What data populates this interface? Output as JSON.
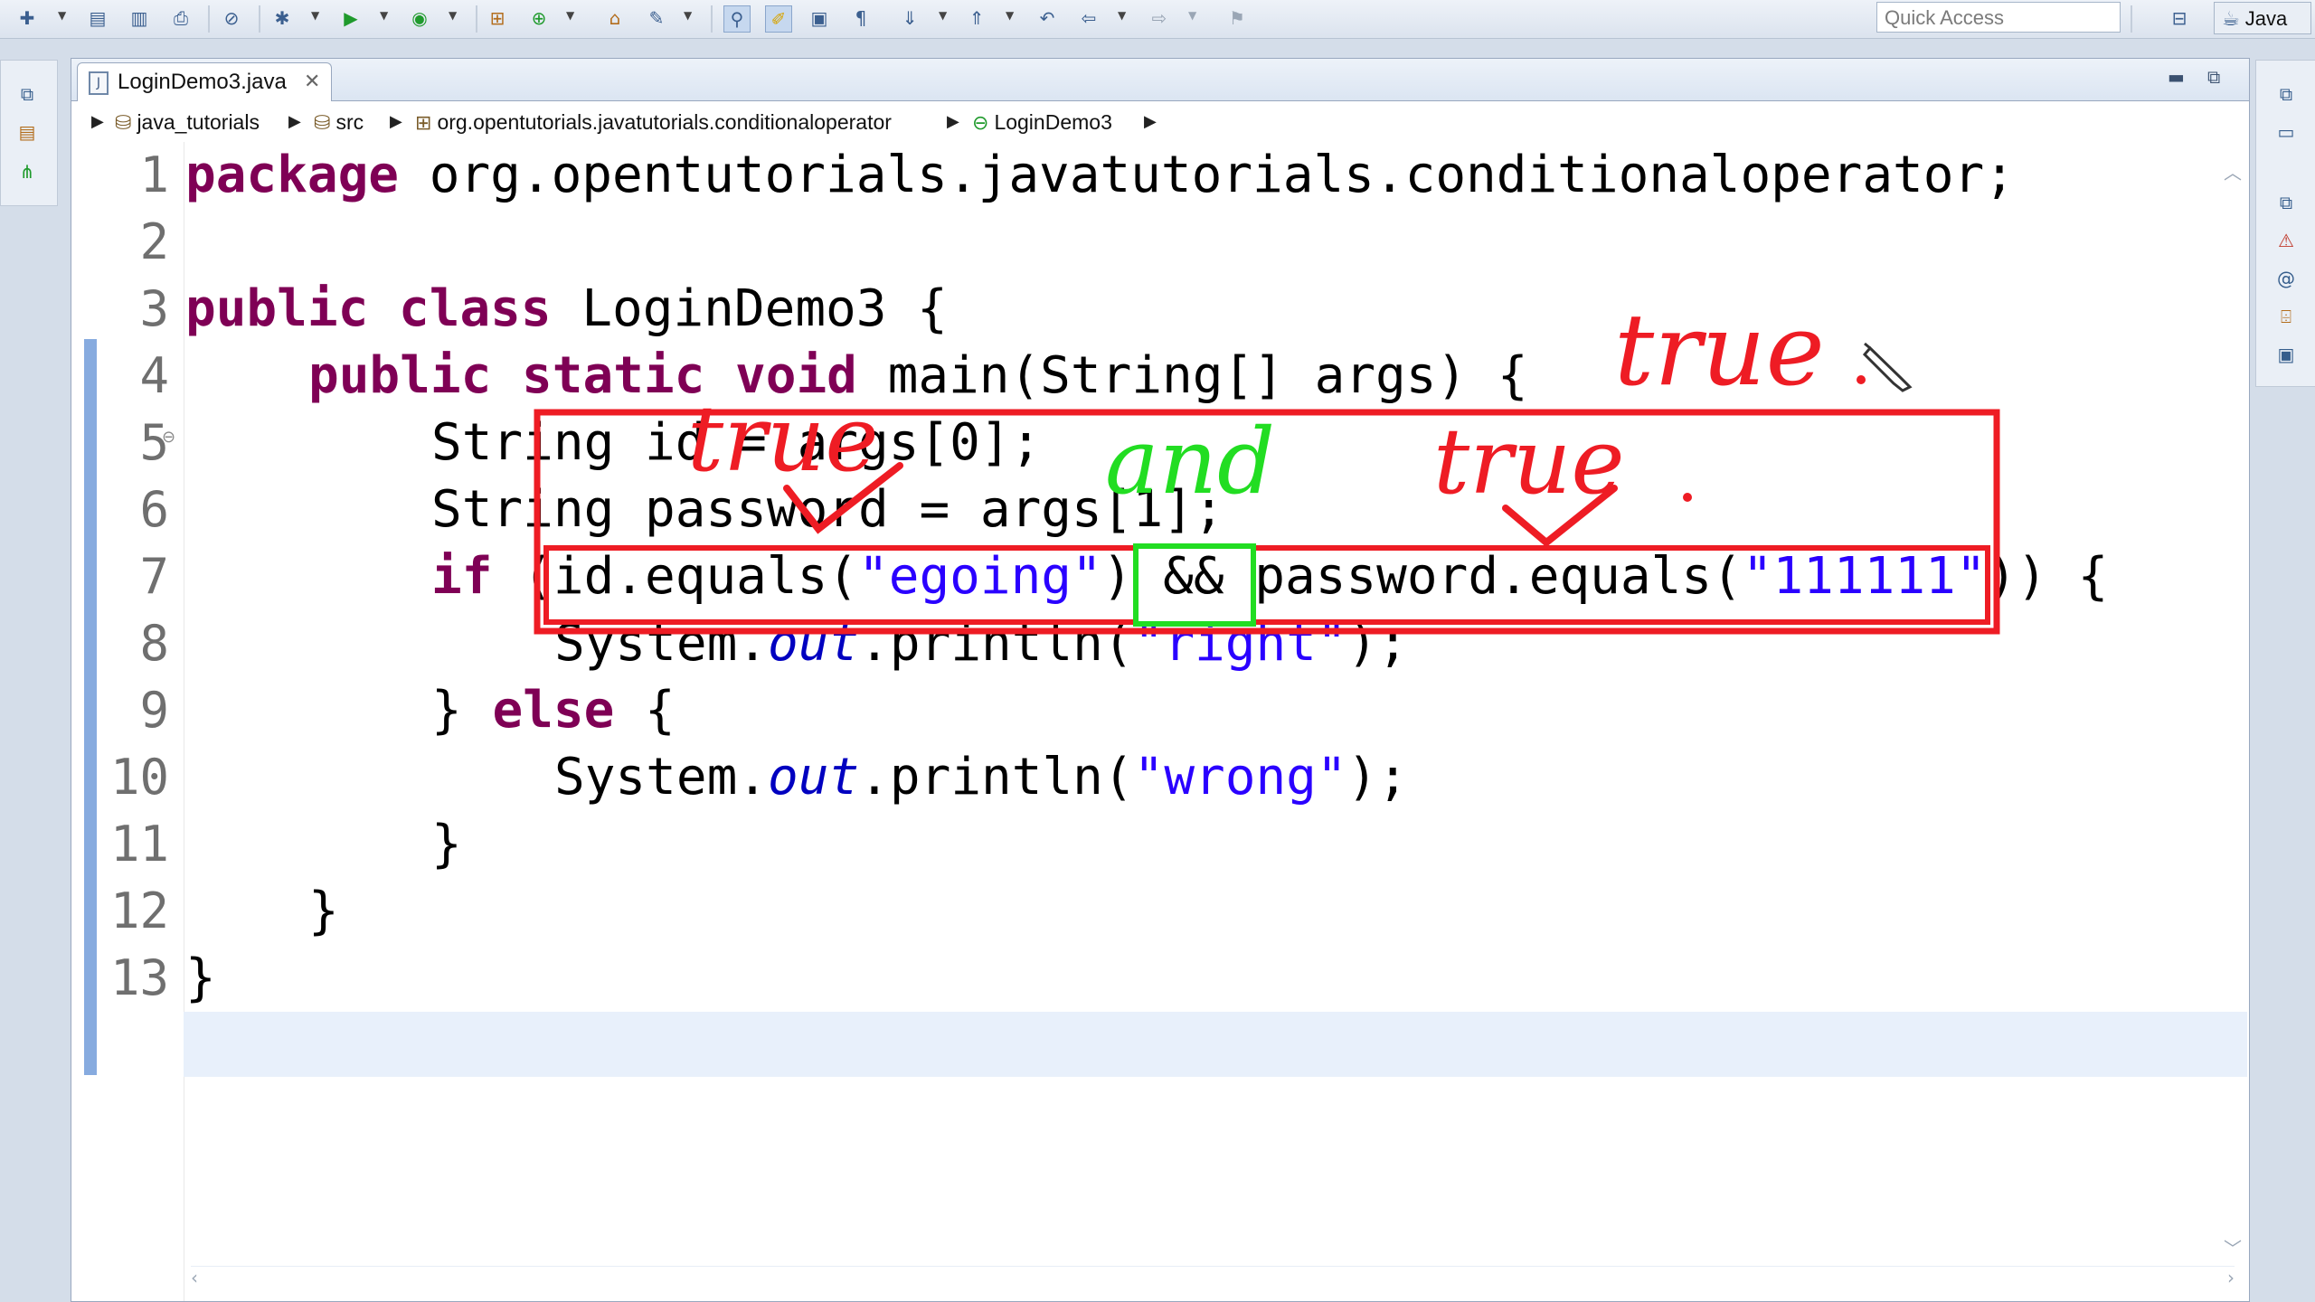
{
  "toolbar": {
    "quick_access_placeholder": "Quick Access",
    "perspective_label": "Java"
  },
  "editor": {
    "tab_label": "LoginDemo3.java",
    "breadcrumb": [
      "java_tutorials",
      "src",
      "org.opentutorials.javatutorials.conditionaloperator",
      "LoginDemo3"
    ],
    "line_numbers": [
      "1",
      "2",
      "3",
      "4",
      "5",
      "6",
      "7",
      "8",
      "9",
      "10",
      "11",
      "12",
      "13"
    ],
    "code": {
      "l1_kw": "package",
      "l1_rest": " org.opentutorials.javatutorials.conditionaloperator;",
      "l3_kw1": "public",
      "l3_kw2": "class",
      "l3_rest": " LoginDemo3 {",
      "l4_kw1": "public",
      "l4_kw2": "static",
      "l4_kw3": "void",
      "l4_rest": " main(String[] args) {",
      "l5": "String id = args[0];",
      "l6": "String password = args[1];",
      "l7_kw": "if",
      "l7_a": " (id.equals(",
      "l7_s1": "\"egoing\"",
      "l7_b": ") && password.equals(",
      "l7_s2": "\"111111\"",
      "l7_c": ")) {",
      "l8_a": "System.",
      "l8_f": "out",
      "l8_b": ".println(",
      "l8_s": "\"right\"",
      "l8_c": ");",
      "l9_a": "} ",
      "l9_kw": "else",
      "l9_b": " {",
      "l10_a": "System.",
      "l10_f": "out",
      "l10_b": ".println(",
      "l10_s": "\"wrong\"",
      "l10_c": ");",
      "l11": "}",
      "l12": "}",
      "l13": "}"
    }
  },
  "annotations": {
    "top_true": "true",
    "left_true": "true",
    "right_true": "true",
    "and": "and",
    "colors": {
      "red": "#ee1c24",
      "green": "#22dd22"
    }
  }
}
